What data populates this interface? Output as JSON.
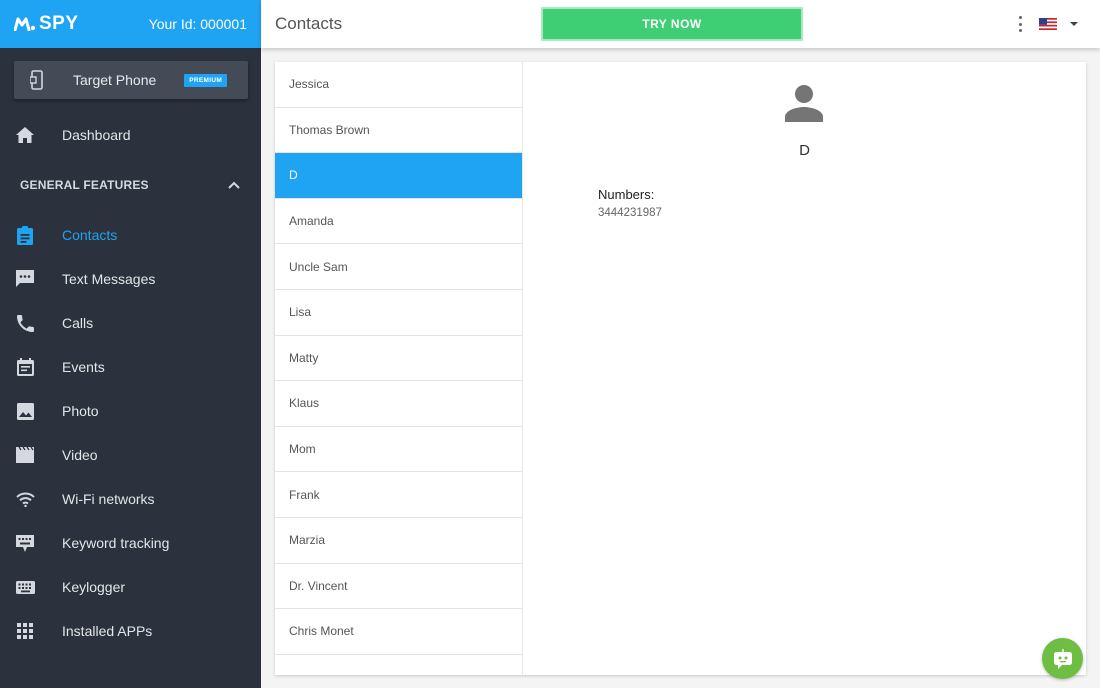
{
  "brand": {
    "logo_text": "SPY",
    "user_id": "Your Id: 000001"
  },
  "target_phone": {
    "label": "Target Phone",
    "badge": "PREMIUM"
  },
  "sidebar": {
    "dashboard": "Dashboard",
    "section_title": "GENERAL FEATURES",
    "items": [
      {
        "label": "Contacts",
        "icon": "contacts-icon",
        "active": true
      },
      {
        "label": "Text Messages",
        "icon": "message-icon"
      },
      {
        "label": "Calls",
        "icon": "phone-icon"
      },
      {
        "label": "Events",
        "icon": "calendar-icon"
      },
      {
        "label": "Photo",
        "icon": "image-icon"
      },
      {
        "label": "Video",
        "icon": "movie-icon"
      },
      {
        "label": "Wi-Fi networks",
        "icon": "wifi-icon"
      },
      {
        "label": "Keyword tracking",
        "icon": "keyword-icon"
      },
      {
        "label": "Keylogger",
        "icon": "keyboard-icon"
      },
      {
        "label": "Installed APPs",
        "icon": "apps-grid-icon"
      }
    ]
  },
  "header": {
    "title": "Contacts",
    "try_now": "TRY NOW"
  },
  "contacts": [
    "Jessica",
    "Thomas Brown",
    "D",
    "Amanda",
    "Uncle Sam",
    "Lisa",
    "Matty",
    "Klaus",
    "Mom",
    "Frank",
    "Marzia",
    "Dr. Vincent",
    "Chris Monet"
  ],
  "selected_contact": {
    "name": "D",
    "numbers_label": "Numbers:",
    "number": "3444231987"
  },
  "colors": {
    "accent": "#1fa4f3",
    "sidebar": "#2b313d",
    "try_now": "#3ecf74",
    "chat": "#6fbe44"
  }
}
